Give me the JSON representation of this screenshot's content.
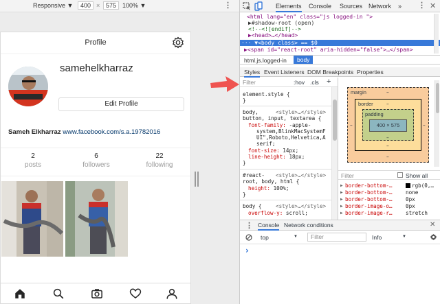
{
  "device_toolbar": {
    "mode": "Responsive ▼",
    "width": "400",
    "times": "×",
    "height": "575",
    "zoom": "100% ▼"
  },
  "profile": {
    "header_title": "Profile",
    "username": "samehelkharraz",
    "edit_label": "Edit Profile",
    "bio_name": "Sameh Elkharraz",
    "bio_link": "www.facebook.com/s.a.19782016",
    "stats": [
      {
        "num": "2",
        "label": "posts"
      },
      {
        "num": "6",
        "label": "followers"
      },
      {
        "num": "22",
        "label": "following"
      }
    ]
  },
  "devtools": {
    "tabs": [
      "Elements",
      "Console",
      "Sources",
      "Network",
      "»"
    ],
    "dom_lines": [
      "<html lang=\"en\" class=\"js logged-in \">",
      "▶#shadow-root (open)",
      "  <!--<![endif]-->",
      "▶<head>…</head>",
      "··· ▼<body class> == $0",
      "   ▶<span id=\"react-root\" aria-hidden=\"false\">…</span>"
    ],
    "crumbs": [
      "html.js.logged-in",
      "body"
    ],
    "sub_tabs": [
      "Styles",
      "Event Listeners",
      "DOM Breakpoints",
      "Properties"
    ],
    "filter": {
      "placeholder": "Filter",
      "hov": ":hov",
      "cls": ".cls",
      "plus": "+"
    },
    "css": {
      "element_style": "element.style {",
      "close": "}",
      "rule1_sel_a": "body,",
      "rule1_src": "<style>…</style>",
      "rule1_sel_b": "button, input, textarea {",
      "ff_prop": "font-family:",
      "ff_val_1": "-apple-",
      "ff_val_2": "system,BlinkMacSystemF",
      "ff_val_3": "UI\",Roboto,Helvetica,A",
      "ff_val_4": "serif;",
      "fs_prop": "font-size:",
      "fs_val": "14px;",
      "lh_prop": "line-height:",
      "lh_val": "18px;",
      "rule2_sel_a": "#react-",
      "rule2_src": "<style>…</style>",
      "rule2_sel_b": "root, body, html {",
      "h_prop": "height:",
      "h_val": "100%;",
      "rule3_sel": "body {",
      "rule3_src": "<style>…</style>",
      "ov_prop": "overflow-y:",
      "ov_val": "scroll;"
    },
    "box_model": {
      "margin": "margin",
      "border": "border",
      "padding": "padding",
      "content": "400 × 575",
      "dash": "–"
    },
    "computed": {
      "filter": "Filter",
      "show_all": "Show all",
      "rows": [
        {
          "prop": "border-bottom-…",
          "val": "rgb(0,…"
        },
        {
          "prop": "border-bottom-…",
          "val": "none"
        },
        {
          "prop": "border-bottom-…",
          "val": "0px"
        },
        {
          "prop": "border-image-o…",
          "val": "0px"
        },
        {
          "prop": "border-image-r…",
          "val": "stretch"
        }
      ]
    },
    "console_tabs": [
      "Console",
      "Network conditions"
    ],
    "console_bar": {
      "context": "top",
      "filter": "Filter",
      "level": "Info"
    },
    "prompt": "›"
  },
  "colors": {
    "accent": "#3879d9",
    "arrow": "#ef5350",
    "margin": "#f9cc9d",
    "border": "#fddd9b",
    "padding": "#c3d08b",
    "content": "#8cb6c0"
  }
}
